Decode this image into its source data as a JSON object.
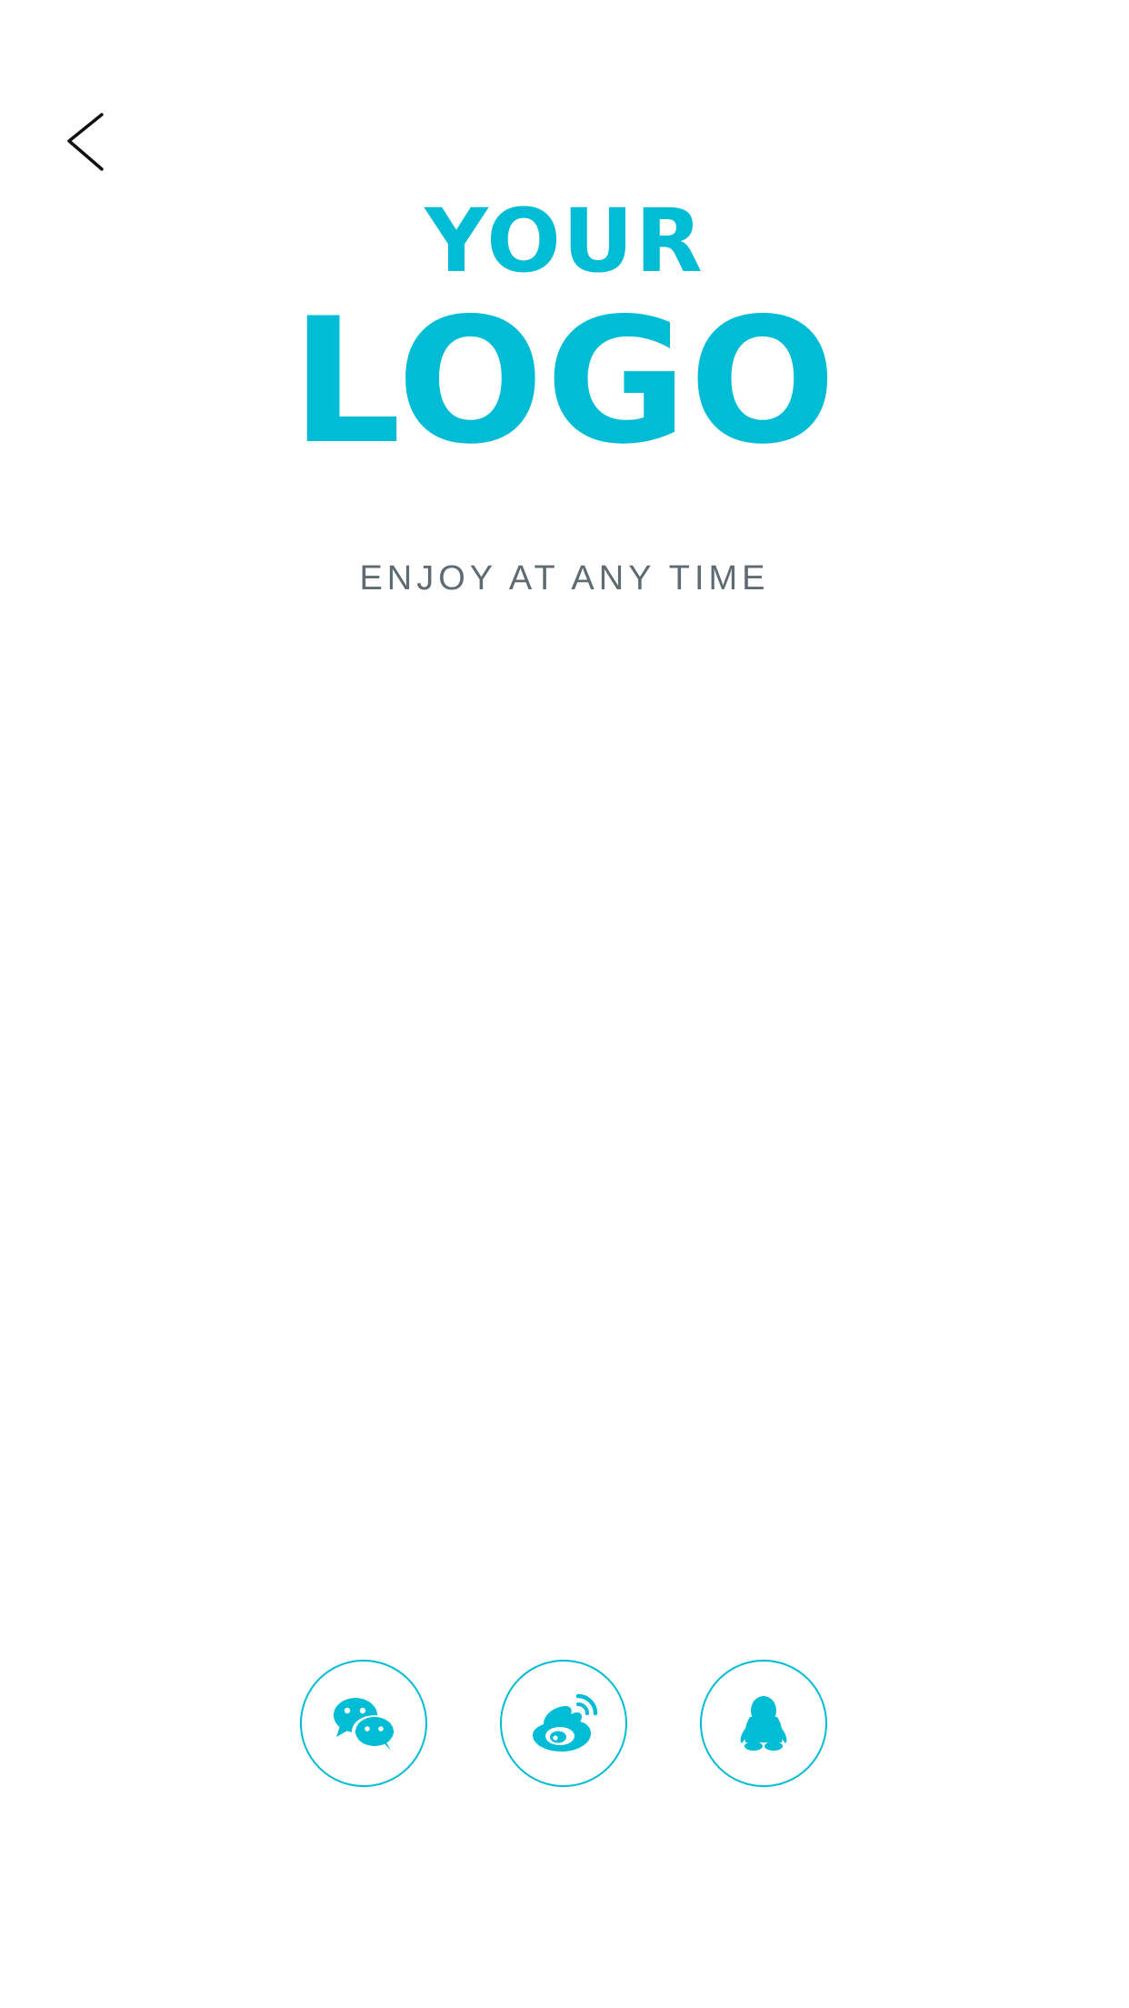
{
  "theme": {
    "accent": "#00bcd4",
    "back_arrow": "#111111",
    "tagline": "#5f6b73",
    "background": "#ffffff"
  },
  "nav": {
    "back_icon": "chevron-left-icon"
  },
  "logo": {
    "line1": "YOUR",
    "line2": "LOGO"
  },
  "tagline": "ENJOY AT ANY TIME",
  "social_login": [
    {
      "name": "WeChat",
      "icon": "wechat-icon"
    },
    {
      "name": "Weibo",
      "icon": "weibo-icon"
    },
    {
      "name": "QQ",
      "icon": "qq-icon"
    }
  ]
}
